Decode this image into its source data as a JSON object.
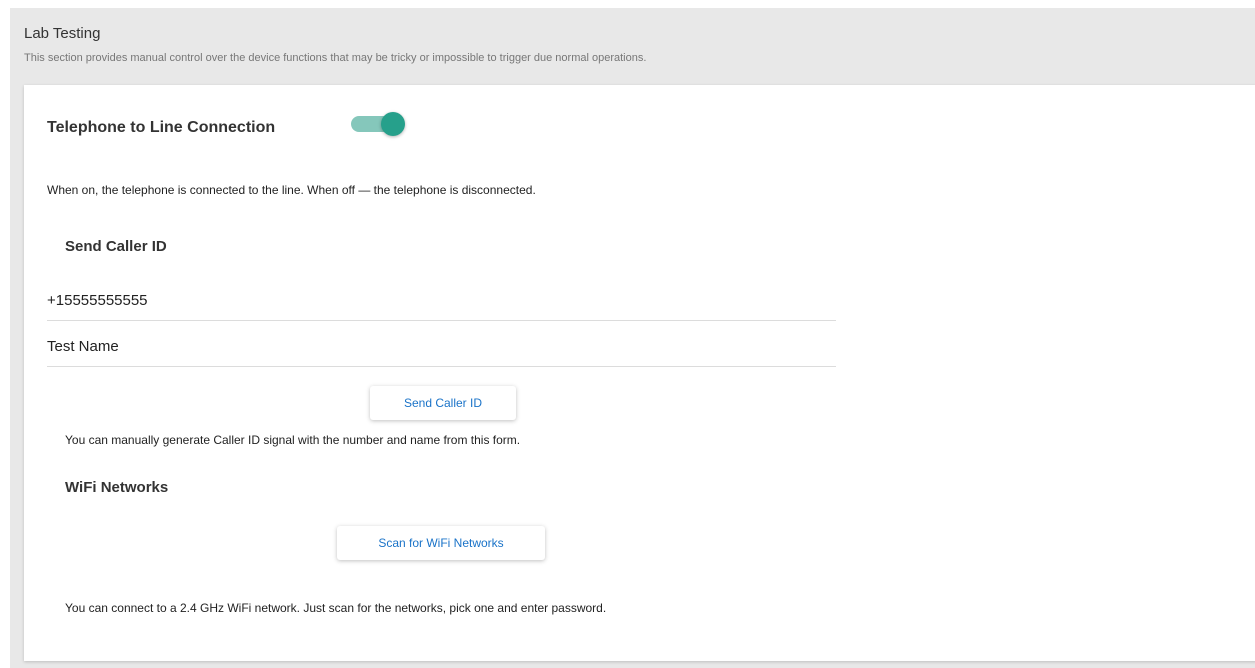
{
  "section": {
    "title": "Lab Testing",
    "description": "This section provides manual control over the device functions that may be tricky or impossible to trigger due normal operations."
  },
  "line_connection": {
    "heading": "Telephone to Line Connection",
    "enabled": true,
    "description": "When on, the telephone is connected to the line. When off — the telephone is disconnected."
  },
  "caller_id": {
    "heading": "Send Caller ID",
    "number_value": "+15555555555",
    "name_value": "Test Name",
    "button_label": "Send Caller ID",
    "description": "You can manually generate Caller ID signal with the number and name from this form."
  },
  "wifi": {
    "heading": "WiFi Networks",
    "button_label": "Scan for WiFi Networks",
    "description": "You can connect to a 2.4 GHz WiFi network. Just scan for the networks, pick one and enter password."
  },
  "colors": {
    "toggle_track": "#85c7bb",
    "toggle_thumb": "#26a08b",
    "button_text": "#1a73c8",
    "background": "#e8e8e8"
  }
}
